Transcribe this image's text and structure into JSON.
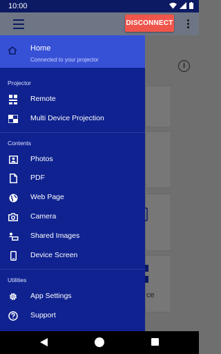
{
  "status": {
    "time": "10:00"
  },
  "appbar": {
    "disconnect_label": "DISCONNECT"
  },
  "drawer": {
    "home": {
      "label": "Home",
      "subtitle": "Connected to your projector"
    },
    "sections": [
      {
        "title": "Projector",
        "items": [
          {
            "label": "Remote",
            "icon": "remote-icon"
          },
          {
            "label": "Multi Device Projection",
            "icon": "multi-device-icon"
          }
        ]
      },
      {
        "title": "Contents",
        "items": [
          {
            "label": "Photos",
            "icon": "photo-icon"
          },
          {
            "label": "PDF",
            "icon": "pdf-document-icon"
          },
          {
            "label": "Web Page",
            "icon": "globe-icon"
          },
          {
            "label": "Camera",
            "icon": "camera-icon"
          },
          {
            "label": "Shared Images",
            "icon": "shared-images-icon"
          },
          {
            "label": "Device Screen",
            "icon": "phone-icon"
          }
        ]
      },
      {
        "title": "Utilities",
        "items": [
          {
            "label": "App Settings",
            "icon": "gear-icon"
          },
          {
            "label": "Support",
            "icon": "help-icon"
          }
        ]
      }
    ]
  },
  "background": {
    "partial_text": "ce",
    "info_glyph": "i"
  },
  "colors": {
    "drawer_bg": "#0f2290",
    "home_highlight": "#3751d6",
    "disconnect_bg": "#f0554b",
    "status_bar": "#0c1a63"
  }
}
